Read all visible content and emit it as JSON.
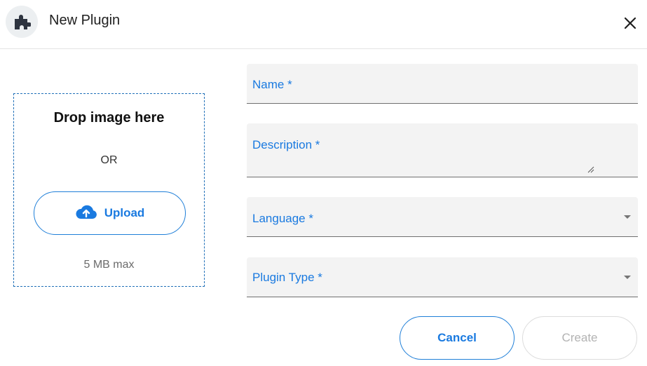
{
  "dialog": {
    "title": "New Plugin",
    "icon": "puzzle-icon",
    "close_icon": "close-icon"
  },
  "dropzone": {
    "title": "Drop image here",
    "or_text": "OR",
    "upload_label": "Upload",
    "upload_icon": "cloud-upload-icon",
    "max_size": "5 MB max"
  },
  "form": {
    "name_label": "Name *",
    "description_label": "Description *",
    "language_label": "Language *",
    "plugin_type_label": "Plugin Type *"
  },
  "actions": {
    "cancel_label": "Cancel",
    "create_label": "Create"
  },
  "colors": {
    "accent": "#1a7ae0",
    "dropzone_border": "#1f6fb8",
    "field_bg": "#f3f3f3",
    "disabled": "#b3b3b3"
  }
}
